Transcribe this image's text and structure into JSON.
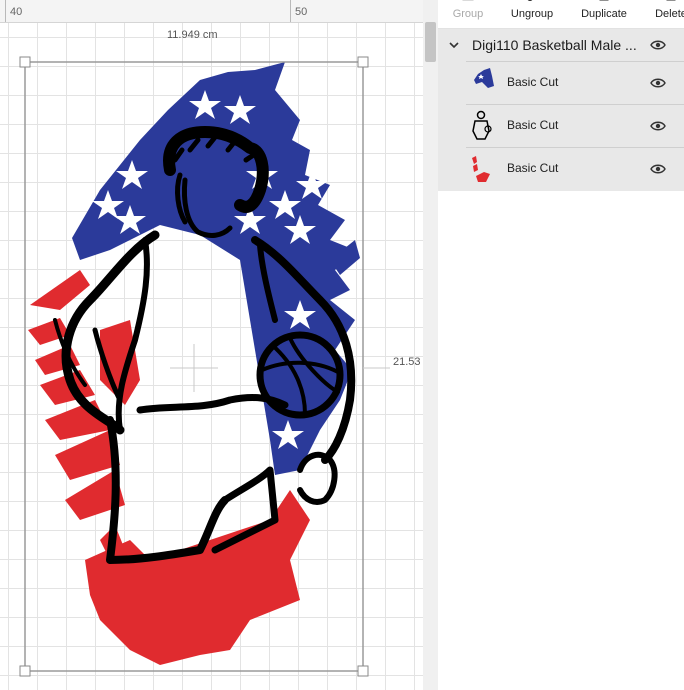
{
  "ruler": {
    "mark_40": "40",
    "mark_50": "50"
  },
  "dimensions": {
    "width": "11.949 cm",
    "height": "21.53"
  },
  "toolbar": {
    "group": "Group",
    "ungroup": "Ungroup",
    "duplicate": "Duplicate",
    "delete": "Delete"
  },
  "layers": {
    "group_title": "Digi110 Basketball Male ...",
    "items": [
      {
        "label": "Basic Cut",
        "icon": "flag-blue-thumbnail"
      },
      {
        "label": "Basic Cut",
        "icon": "player-black-thumbnail"
      },
      {
        "label": "Basic Cut",
        "icon": "stripes-red-thumbnail"
      }
    ]
  },
  "colors": {
    "flag_blue": "#2b3a9a",
    "flag_red": "#e02b2f",
    "outline": "#000000",
    "panel_bg": "#e8e8e8"
  }
}
